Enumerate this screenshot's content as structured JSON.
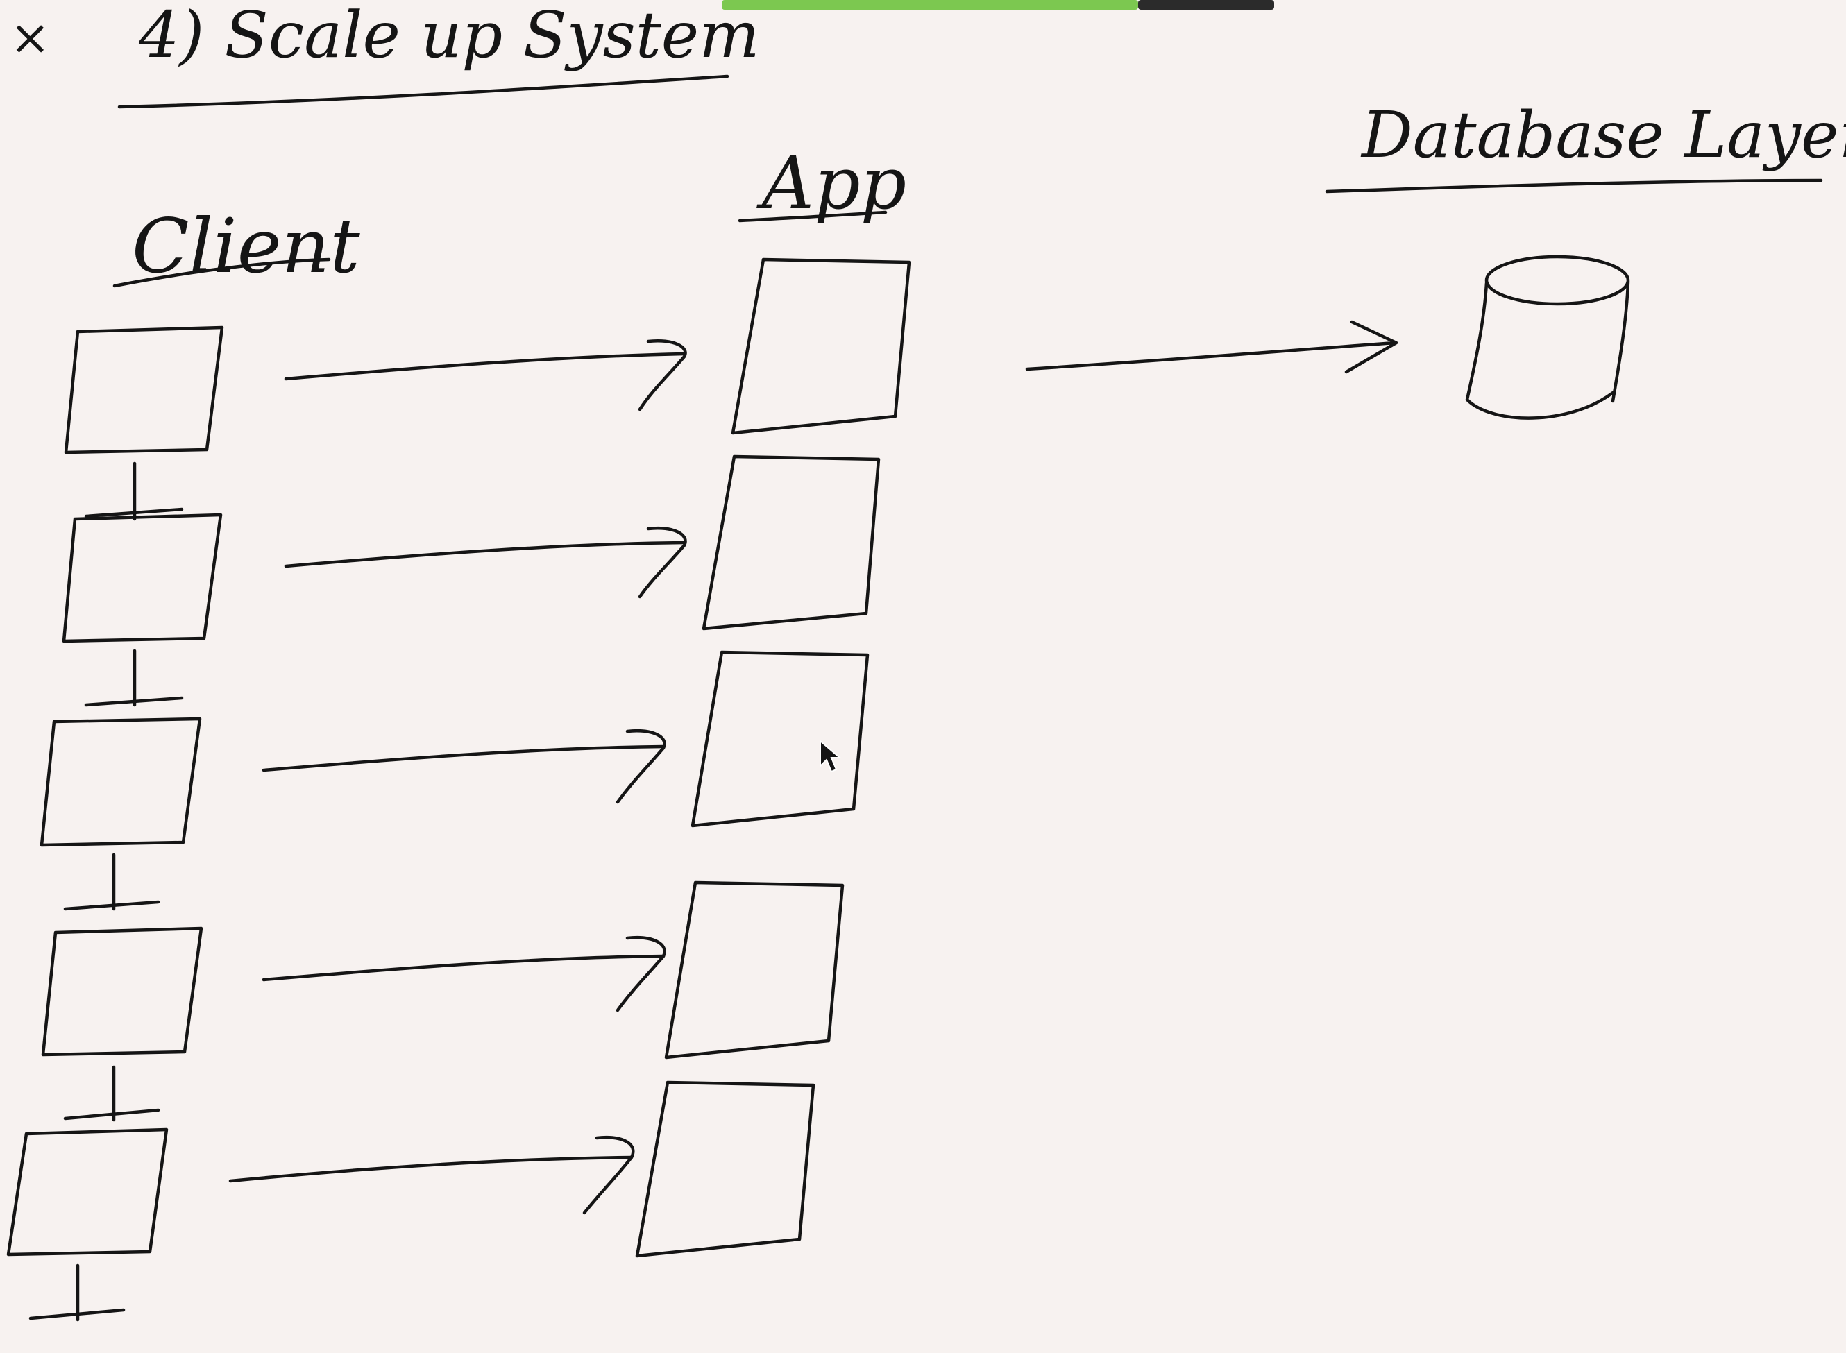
{
  "title": "4) Scale up System",
  "close_glyph": "×",
  "columns": {
    "client": "Client",
    "app": "App",
    "database": "Database Layer"
  },
  "rows": [
    {
      "client": "client-box-1",
      "app": "app-box-1"
    },
    {
      "client": "client-box-2",
      "app": "app-box-2"
    },
    {
      "client": "client-box-3",
      "app": "app-box-3"
    },
    {
      "client": "client-box-4",
      "app": "app-box-4"
    },
    {
      "client": "client-box-5",
      "app": "app-box-5"
    }
  ],
  "colors": {
    "paper": "#f7f2f0",
    "ink": "#151515",
    "banner_green": "#7cc850",
    "banner_dark": "#2b2b2b"
  },
  "icons": {
    "close": "close-icon",
    "pointer": "mouse-cursor-icon",
    "database": "database-cylinder-icon"
  }
}
